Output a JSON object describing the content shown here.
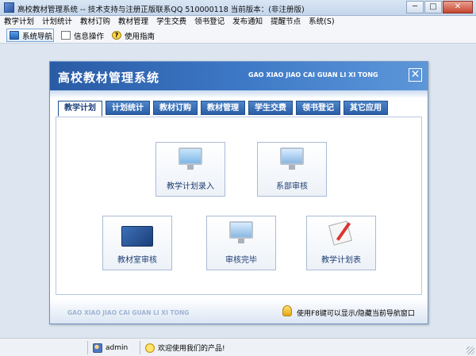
{
  "window": {
    "title": "高校教材管理系统 -- 技术支持与注册正版联系QQ 510000118   当前版本：(非注册版)",
    "buttons": {
      "minimize": "─",
      "maximize": "□",
      "close": "✕"
    }
  },
  "menu": {
    "items": [
      "教学计划",
      "计划统计",
      "教材订购",
      "教材管理",
      "学生交费",
      "领书登记",
      "发布通知",
      "提醒节点",
      "系统(S)"
    ]
  },
  "toolbar": {
    "nav_label": "系统导航",
    "info_label": "信息操作",
    "help_label": "使用指南"
  },
  "panel": {
    "title": "高校教材管理系统",
    "pinyin_title": "GAO XIAO JIAO CAI GUAN LI XI TONG",
    "close_glyph": "✕",
    "tabs": [
      "教学计划",
      "计划统计",
      "教材订购",
      "教材管理",
      "学生交费",
      "领书登记",
      "其它应用"
    ],
    "active_tab": "教学计划",
    "cards": {
      "plan_entry": "教学计划录入",
      "dept_review": "系部审核",
      "room_review": "教材室审核",
      "review_done": "审核完毕",
      "plan_table": "教学计划表"
    },
    "footer_pinyin": "GAO XIAO JIAO CAI GUAN LI XI TONG",
    "footer_hint": "使用F8键可以显示/隐藏当前导航窗口"
  },
  "status": {
    "user": "admin",
    "welcome": "欢迎使用我们的产品!"
  },
  "colors": {
    "header_blue": "#2a5ba5",
    "tab_blue": "#3a6fb5",
    "card_text": "#1d3c72"
  }
}
